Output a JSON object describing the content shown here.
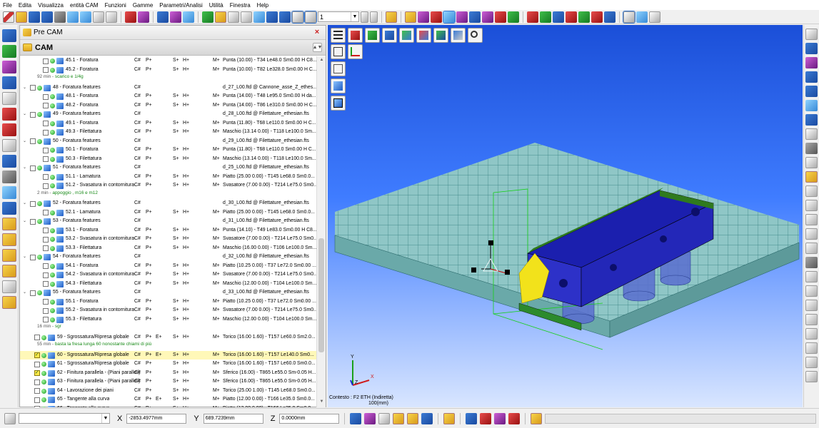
{
  "menu": [
    "File",
    "Edita",
    "Visualizza",
    "entità CAM",
    "Funzioni",
    "Gamme",
    "Parametri/Analisi",
    "Utilità",
    "Finestra",
    "Help"
  ],
  "toolbar": {
    "layer_value": "1"
  },
  "panel": {
    "title": "Pre CAM",
    "subtitle": "CAM",
    "close": "×",
    "collapse": "▲▼"
  },
  "rows": [
    {
      "kind": "op",
      "lvl": 2,
      "name": "45.1 - Foratura",
      "c": "C#",
      "p": "P+",
      "e": "",
      "s": "S+",
      "h": "H+",
      "m": "M+",
      "tool": "Punta (10.00) - T34 Le48.0 Sm0.00 H C8..."
    },
    {
      "kind": "op",
      "lvl": 2,
      "name": "45.2 - Foratura",
      "c": "C#",
      "p": "P+",
      "e": "",
      "s": "S+",
      "h": "H+",
      "m": "M+",
      "tool": "Punta (10.00) - T82 Le328.0 Sm0.00 H C..."
    },
    {
      "kind": "time",
      "time": "92 min",
      "note": "scarico e 1/4g"
    },
    {
      "kind": "grp",
      "name": "48 - Foratura features",
      "c": "C#",
      "tool": "d_27_L00.ftd @ Cannone_asse_Z_ethes..."
    },
    {
      "kind": "op",
      "lvl": 2,
      "name": "48.1 - Foratura",
      "c": "C#",
      "p": "P+",
      "e": "",
      "s": "S+",
      "h": "H+",
      "m": "M+",
      "tool": "Punta (14.00) - T48 Le95.0 Sm0.00 H da..."
    },
    {
      "kind": "op",
      "lvl": 2,
      "name": "48.2 - Foratura",
      "c": "C#",
      "p": "P+",
      "e": "",
      "s": "S+",
      "h": "H+",
      "m": "M+",
      "tool": "Punta (14.00) - T86 Le310.0 Sm0.00 H C..."
    },
    {
      "kind": "grp",
      "name": "49 - Foratura features",
      "c": "C#",
      "tool": "d_28_L00.ftd @ Filettature_ethesian.fts"
    },
    {
      "kind": "op",
      "lvl": 2,
      "name": "49.1 - Foratura",
      "c": "C#",
      "p": "P+",
      "e": "",
      "s": "S+",
      "h": "H+",
      "m": "M+",
      "tool": "Punta (11.80) - T68 Le110.0 Sm0.00 H C..."
    },
    {
      "kind": "op",
      "lvl": 2,
      "name": "49.3 - Filettatura",
      "c": "C#",
      "p": "P+",
      "e": "",
      "s": "S+",
      "h": "H+",
      "m": "M+",
      "tool": "Maschio (13.14 0.00) - T118 Le100.0 Sm..."
    },
    {
      "kind": "grp",
      "name": "50 - Foratura features",
      "c": "C#",
      "tool": "d_29_L00.ftd @ Filettature_ethesian.fts"
    },
    {
      "kind": "op",
      "lvl": 2,
      "name": "50.1 - Foratura",
      "c": "C#",
      "p": "P+",
      "e": "",
      "s": "S+",
      "h": "H+",
      "m": "M+",
      "tool": "Punta (11.80) - T68 Le110.0 Sm0.00 H C..."
    },
    {
      "kind": "op",
      "lvl": 2,
      "name": "50.3 - Filettatura",
      "c": "C#",
      "p": "P+",
      "e": "",
      "s": "S+",
      "h": "H+",
      "m": "M+",
      "tool": "Maschio (13.14 0.00) - T118 Le100.0 Sm..."
    },
    {
      "kind": "grp",
      "name": "51 - Foratura features",
      "c": "C#",
      "tool": "d_25_L00.ftd @ Filettature_ethesian.fts"
    },
    {
      "kind": "op",
      "lvl": 2,
      "name": "51.1 - Lamatura",
      "c": "C#",
      "p": "P+",
      "e": "",
      "s": "S+",
      "h": "H+",
      "m": "M+",
      "tool": "Piatto (25.00 0.00) - T145 Le68.0 Sm0.0..."
    },
    {
      "kind": "op",
      "lvl": 2,
      "name": "51.2 - Svasatura in contornitura",
      "c": "C#",
      "p": "P+",
      "e": "",
      "s": "S+",
      "h": "H+",
      "m": "M+",
      "tool": "Svasatore (7.00 0.00) - T214 Le75.0 Sm0..."
    },
    {
      "kind": "time",
      "time": "2 min",
      "note": "appoggio , m16 e m12"
    },
    {
      "kind": "grp",
      "name": "52 - Foratura features",
      "c": "C#",
      "tool": "d_30_L00.ftd @ Filettature_ethesian.fts"
    },
    {
      "kind": "op",
      "lvl": 2,
      "name": "52.1 - Lamatura",
      "c": "C#",
      "p": "P+",
      "e": "",
      "s": "S+",
      "h": "H+",
      "m": "M+",
      "tool": "Piatto (25.00 0.00) - T145 Le68.0 Sm0.0..."
    },
    {
      "kind": "grp",
      "name": "53 - Foratura features",
      "c": "C#",
      "tool": "d_31_L00.ftd @ Filettature_ethesian.fts"
    },
    {
      "kind": "op",
      "lvl": 2,
      "name": "53.1 - Foratura",
      "c": "C#",
      "p": "P+",
      "e": "",
      "s": "S+",
      "h": "H+",
      "m": "M+",
      "tool": "Punta (14.10) - T49 Le83.0 Sm0.00 H C8..."
    },
    {
      "kind": "op",
      "lvl": 2,
      "name": "53.2 - Svasatura in contornitura",
      "c": "C#",
      "p": "P+",
      "e": "",
      "s": "S+",
      "h": "H+",
      "m": "M+",
      "tool": "Svasatore (7.00 0.00) - T214 Le75.0 Sm0..."
    },
    {
      "kind": "op",
      "lvl": 2,
      "name": "53.3 - Filettatura",
      "c": "C#",
      "p": "P+",
      "e": "",
      "s": "S+",
      "h": "H+",
      "m": "M+",
      "tool": "Maschio (16.00 0.00) - T106 Le100.0 Sm..."
    },
    {
      "kind": "grp",
      "name": "54 - Foratura features",
      "c": "C#",
      "tool": "d_32_L00.ftd @ Filettature_ethesian.fts"
    },
    {
      "kind": "op",
      "lvl": 2,
      "name": "54.1 - Foratura",
      "c": "C#",
      "p": "P+",
      "e": "",
      "s": "S+",
      "h": "H+",
      "m": "M+",
      "tool": "Piatto (10.25 0.00) - T37 Le72.0 Sm0.00 ..."
    },
    {
      "kind": "op",
      "lvl": 2,
      "name": "54.2 - Svasatura in contornitura",
      "c": "C#",
      "p": "P+",
      "e": "",
      "s": "S+",
      "h": "H+",
      "m": "M+",
      "tool": "Svasatore (7.00 0.00) - T214 Le75.0 Sm0..."
    },
    {
      "kind": "op",
      "lvl": 2,
      "name": "54.3 - Filettatura",
      "c": "C#",
      "p": "P+",
      "e": "",
      "s": "S+",
      "h": "H+",
      "m": "M+",
      "tool": "Maschio (12.00 0.00) - T104 Le100.0 Sm..."
    },
    {
      "kind": "grp",
      "name": "55 - Foratura features",
      "c": "C#",
      "tool": "d_33_L00.ftd @ Filettature_ethesian.fts"
    },
    {
      "kind": "op",
      "lvl": 2,
      "name": "55.1 - Foratura",
      "c": "C#",
      "p": "P+",
      "e": "",
      "s": "S+",
      "h": "H+",
      "m": "M+",
      "tool": "Piatto (10.25 0.00) - T37 Le72.0 Sm0.00 ..."
    },
    {
      "kind": "op",
      "lvl": 2,
      "name": "55.2 - Svasatura in contornitura",
      "c": "C#",
      "p": "P+",
      "e": "",
      "s": "S+",
      "h": "H+",
      "m": "M+",
      "tool": "Svasatore (7.00 0.00) - T214 Le75.0 Sm0..."
    },
    {
      "kind": "op",
      "lvl": 2,
      "name": "55.3 - Filettatura",
      "c": "C#",
      "p": "P+",
      "e": "",
      "s": "S+",
      "h": "H+",
      "m": "M+",
      "tool": "Maschio (12.00 0.00) - T104 Le100.0 Sm..."
    },
    {
      "kind": "time",
      "time": "16 min",
      "note": "sgr"
    },
    {
      "kind": "op",
      "lvl": 1,
      "name": "59 - Sgrossatura/Ripresa globale",
      "c": "C#",
      "p": "P+",
      "e": "E+",
      "s": "S+",
      "h": "H+",
      "m": "M+",
      "tool": "Torico (16.00 1.60) - T157 Le60.0 Sm2.0..."
    },
    {
      "kind": "time",
      "time": "55 min",
      "note": "basta la fresa lunga 60 nonostante chiami di più"
    },
    {
      "kind": "op",
      "lvl": 1,
      "checked": true,
      "name": "60 - Sgrossatura/Ripresa globale",
      "c": "C#",
      "p": "P+",
      "e": "E+",
      "s": "S+",
      "h": "H+",
      "m": "M+",
      "tool": "Torico (16.00 1.60) - T157 Le140.0 Sm0..."
    },
    {
      "kind": "op",
      "lvl": 1,
      "name": "61 - Sgrossatura/Ripresa globale",
      "c": "C#",
      "p": "P+",
      "e": "",
      "s": "S+",
      "h": "H+",
      "m": "M+",
      "tool": "Torico (16.00 1.60) - T157 Le60.0 Sm0.0..."
    },
    {
      "kind": "op",
      "lvl": 1,
      "yellow": true,
      "name": "62 - Finitura parallela - (Piani paralleli)",
      "c": "C#",
      "p": "P+",
      "e": "",
      "s": "S+",
      "h": "H+",
      "m": "M+",
      "tool": "Sferico (16.00) - T865 Le55.0 Sm-0.05 H..."
    },
    {
      "kind": "op",
      "lvl": 1,
      "name": "63 - Finitura parallela - (Piani paralleli)",
      "c": "C#",
      "p": "P+",
      "e": "",
      "s": "S+",
      "h": "H+",
      "m": "M+",
      "tool": "Sferico (16.00) - T865 Le55.0 Sm-0.05 H..."
    },
    {
      "kind": "op",
      "lvl": 1,
      "name": "64 - Lavorazione dei piani",
      "c": "C#",
      "p": "P+",
      "e": "",
      "s": "S+",
      "h": "H+",
      "m": "M+",
      "tool": "Torico (25.00 1.00) - T145 Le68.0 Sm0.0..."
    },
    {
      "kind": "op",
      "lvl": 1,
      "name": "65 - Tangente alla curva",
      "c": "C#",
      "p": "P+",
      "e": "E+",
      "s": "S+",
      "h": "H+",
      "m": "M+",
      "tool": "Piatto (12.00 0.00) - T166 Le35.0 Sm0.0..."
    },
    {
      "kind": "op",
      "lvl": 1,
      "name": "66 - Tangente alla curva",
      "c": "C#",
      "p": "P+",
      "e": "",
      "s": "S+",
      "h": "H+",
      "m": "M+",
      "tool": "Piatto (12.00 0.00) - T166 Le35.0 Sm0.0..."
    }
  ],
  "viewport": {
    "context": "Contesto : F2 ETH (Indiretta)",
    "scale": "100(mm)",
    "axis_labels": {
      "x": "X",
      "y": "Y",
      "z": "Z"
    },
    "bg_top": "#1b4fd8",
    "bg_bottom": "#d9e6ff"
  },
  "status": {
    "x_label": "X",
    "x_value": "-2853.4977mm",
    "y_label": "Y",
    "y_value": "689.7239mm",
    "z_label": "Z",
    "z_value": "0.0000mm"
  }
}
